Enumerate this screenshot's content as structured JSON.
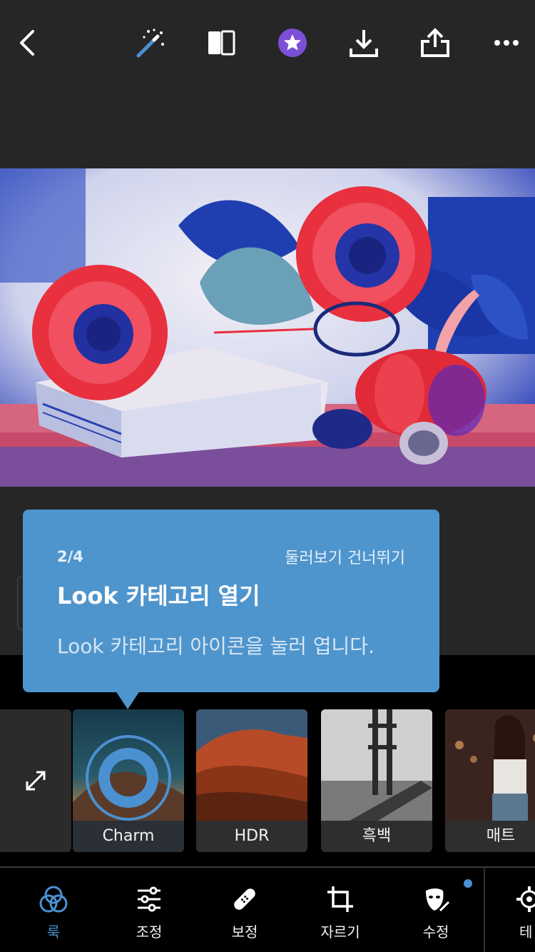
{
  "tooltip": {
    "step": "2/4",
    "skip_label": "둘러보기 건너뛰기",
    "title": "Look 카테고리 열기",
    "description": "Look 카테고리 아이콘을 눌러 엽니다."
  },
  "presets": [
    {
      "label": "Charm",
      "selected": true
    },
    {
      "label": "HDR",
      "selected": false
    },
    {
      "label": "흑백",
      "selected": false
    },
    {
      "label": "매트",
      "selected": false
    }
  ],
  "nav": [
    {
      "label": "룩",
      "active": true
    },
    {
      "label": "조정",
      "active": false
    },
    {
      "label": "보정",
      "active": false
    },
    {
      "label": "자르기",
      "active": false
    },
    {
      "label": "수정",
      "active": false,
      "badge": true
    },
    {
      "label": "테",
      "active": false
    }
  ],
  "colors": {
    "accent": "#4b90d1",
    "tooltip_bg": "#4f95cd",
    "premium_badge": "#7b4fd6",
    "background": "#262626"
  },
  "icons": {
    "top": [
      "back-icon",
      "magic-wand-icon",
      "compare-icon",
      "premium-star-icon",
      "download-icon",
      "share-icon",
      "more-icon"
    ],
    "expand": "expand-icon"
  }
}
